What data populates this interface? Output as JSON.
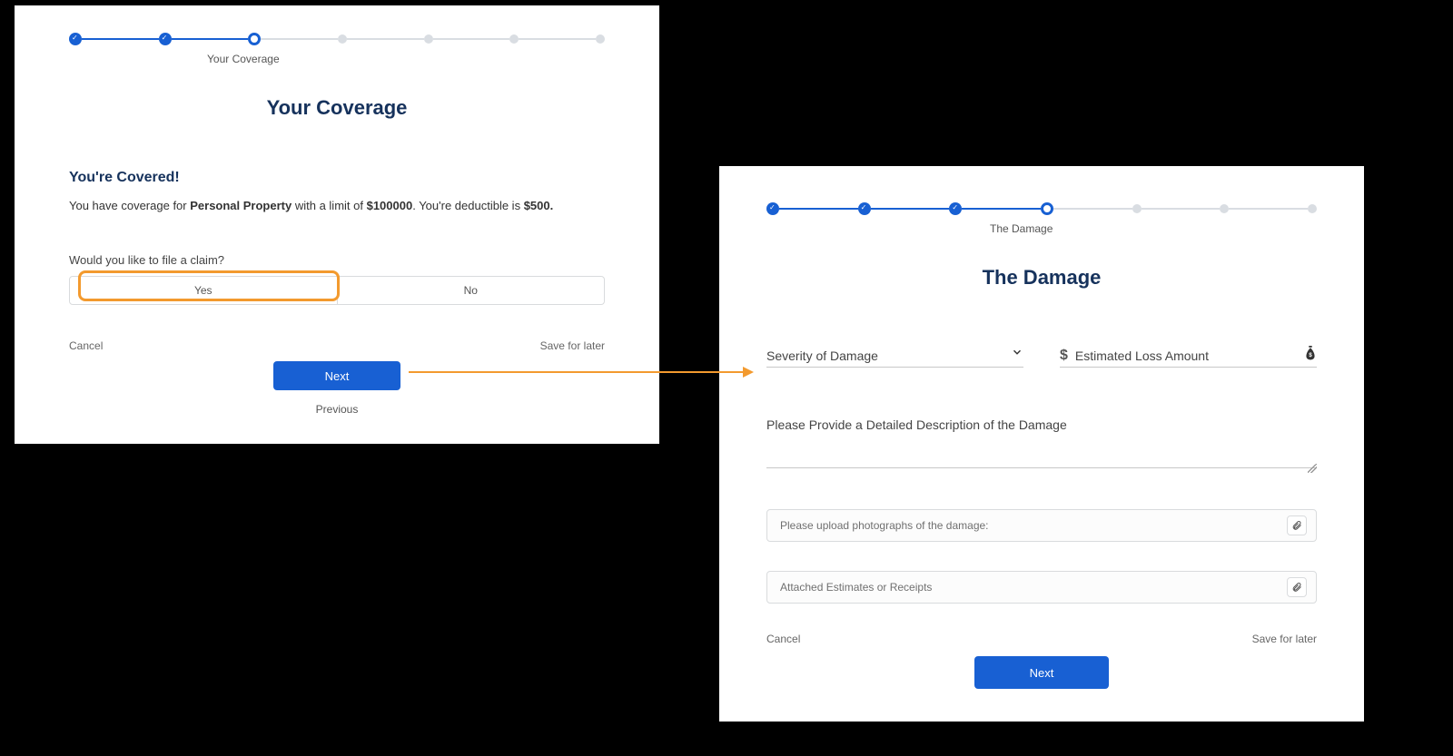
{
  "panel1": {
    "progress": {
      "step_label": "Your Coverage"
    },
    "title": "Your Coverage",
    "covered_heading": "You're Covered!",
    "coverage_sentence_prefix": "You have coverage for ",
    "coverage_type": "Personal Property",
    "coverage_mid": " with a limit of ",
    "coverage_limit": "$100000",
    "coverage_suffix1": ".  You're deductible is ",
    "deductible": "$500.",
    "question": "Would you like to file a claim?",
    "yes_label": "Yes",
    "no_label": "No",
    "cancel": "Cancel",
    "save": "Save for later",
    "next": "Next",
    "previous": "Previous"
  },
  "panel2": {
    "progress": {
      "step_label": "The Damage"
    },
    "title": "The Damage",
    "severity_placeholder": "Severity of Damage",
    "loss_placeholder": "Estimated Loss Amount",
    "desc_label": "Please Provide a Detailed Description of the Damage",
    "upload_photos": "Please upload photographs of the damage:",
    "upload_receipts": "Attached Estimates or Receipts",
    "cancel": "Cancel",
    "save": "Save for later",
    "next": "Next"
  }
}
